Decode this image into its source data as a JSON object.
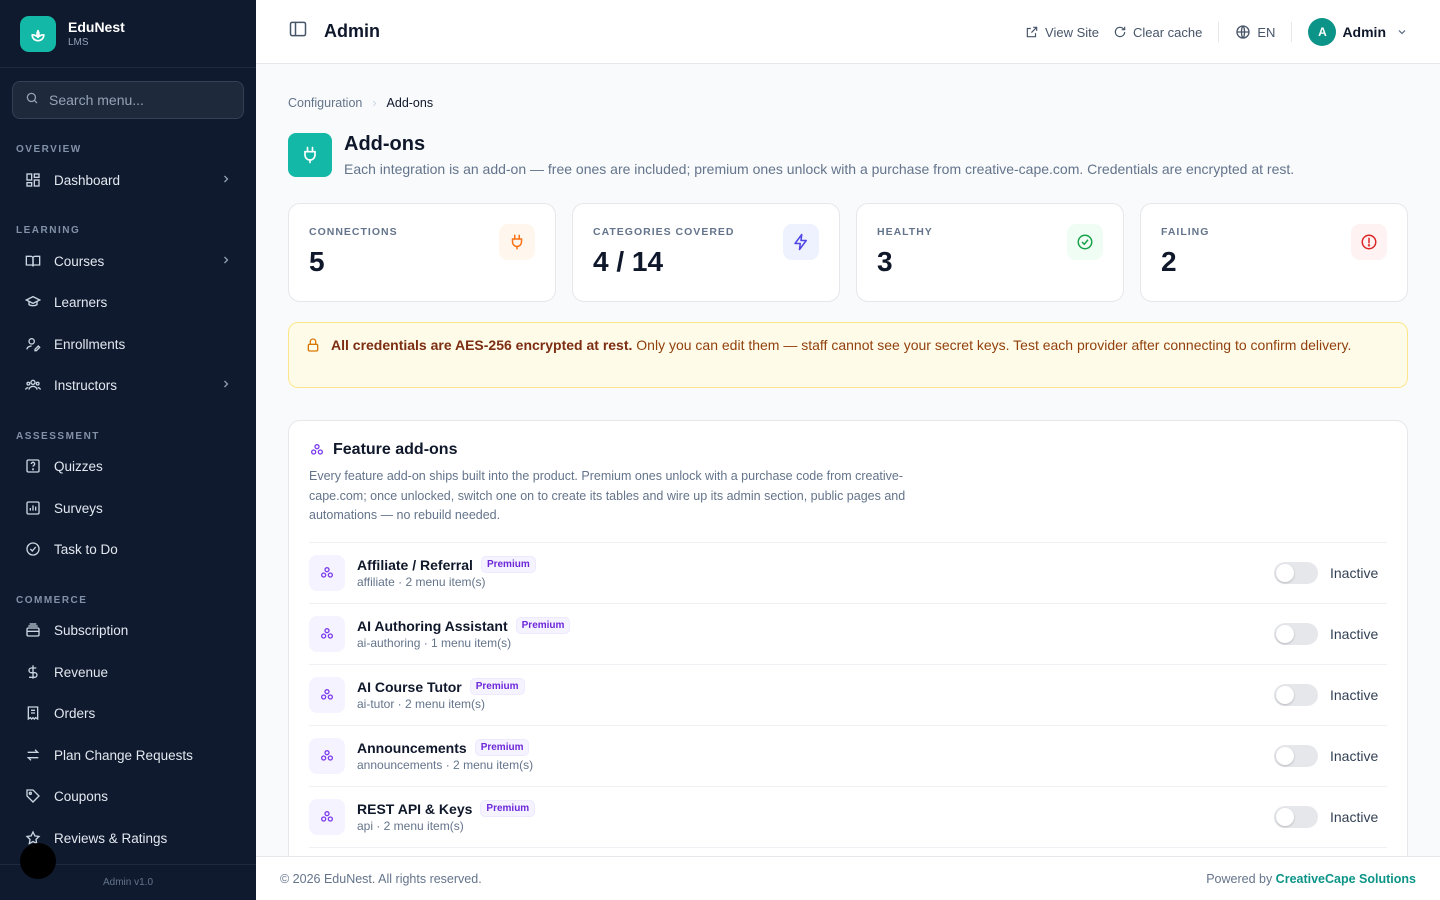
{
  "brand": {
    "name": "EduNest",
    "sub": "LMS"
  },
  "search": {
    "placeholder": "Search menu..."
  },
  "sidebar": {
    "sections": [
      "OVERVIEW",
      "LEARNING",
      "ASSESSMENT",
      "COMMERCE"
    ],
    "items": [
      {
        "label": "Dashboard",
        "icon": "dashboard-icon",
        "has_children": true
      },
      {
        "label": "Courses",
        "icon": "book-icon",
        "has_children": true
      },
      {
        "label": "Learners",
        "icon": "graduation-cap-icon",
        "has_children": false
      },
      {
        "label": "Enrollments",
        "icon": "user-edit-icon",
        "has_children": false
      },
      {
        "label": "Instructors",
        "icon": "users-icon",
        "has_children": true
      },
      {
        "label": "Quizzes",
        "icon": "quiz-icon",
        "has_children": false
      },
      {
        "label": "Surveys",
        "icon": "chart-icon",
        "has_children": false
      },
      {
        "label": "Task to Do",
        "icon": "check-circle-icon",
        "has_children": false
      },
      {
        "label": "Subscription",
        "icon": "stack-icon",
        "has_children": false
      },
      {
        "label": "Revenue",
        "icon": "dollar-icon",
        "has_children": false
      },
      {
        "label": "Orders",
        "icon": "receipt-icon",
        "has_children": false
      },
      {
        "label": "Plan Change Requests",
        "icon": "swap-icon",
        "has_children": false
      },
      {
        "label": "Coupons",
        "icon": "tag-icon",
        "has_children": false
      },
      {
        "label": "Reviews & Ratings",
        "icon": "star-icon",
        "has_children": false
      }
    ],
    "footer": "Admin v1.0"
  },
  "header": {
    "title": "Admin",
    "view_site": "View Site",
    "clear_cache": "Clear cache",
    "language": "EN",
    "avatar_initial": "A",
    "user": "Admin"
  },
  "breadcrumb": {
    "parent": "Configuration",
    "current": "Add-ons"
  },
  "page": {
    "title": "Add-ons",
    "description": "Each integration is an add-on — free ones are included; premium ones unlock with a purchase from creative-cape.com. Credentials are encrypted at rest."
  },
  "stats": [
    {
      "label": "CONNECTIONS",
      "value": "5",
      "icon": "plug-icon",
      "color": "#f97316",
      "bg": "#fff7ed"
    },
    {
      "label": "CATEGORIES COVERED",
      "value": "4 / 14",
      "icon": "bolt-icon",
      "color": "#4f46e5",
      "bg": "#eef2ff"
    },
    {
      "label": "HEALTHY",
      "value": "3",
      "icon": "check-circle-icon",
      "color": "#16a34a",
      "bg": "#f0fdf4"
    },
    {
      "label": "FAILING",
      "value": "2",
      "icon": "alert-circle-icon",
      "color": "#dc2626",
      "bg": "#fef2f2"
    }
  ],
  "notice": {
    "strong": "All credentials are AES-256 encrypted at rest.",
    "text": " Only you can edit them — staff cannot see your secret keys. Test each provider after connecting to confirm delivery."
  },
  "panel": {
    "title": "Feature add-ons",
    "description": "Every feature add-on ships built into the product. Premium ones unlock with a purchase code from creative-cape.com; once unlocked, switch one on to create its tables and wire up its admin section, public pages and automations — no rebuild needed.",
    "addons": [
      {
        "name": "Affiliate / Referral",
        "badge": "Premium",
        "slug": "affiliate · 2 menu item(s)",
        "status": "Inactive"
      },
      {
        "name": "AI Authoring Assistant",
        "badge": "Premium",
        "slug": "ai-authoring · 1 menu item(s)",
        "status": "Inactive"
      },
      {
        "name": "AI Course Tutor",
        "badge": "Premium",
        "slug": "ai-tutor · 2 menu item(s)",
        "status": "Inactive"
      },
      {
        "name": "Announcements",
        "badge": "Premium",
        "slug": "announcements · 2 menu item(s)",
        "status": "Inactive"
      },
      {
        "name": "REST API & Keys",
        "badge": "Premium",
        "slug": "api · 2 menu item(s)",
        "status": "Inactive"
      }
    ]
  },
  "footer": {
    "copyright": "© 2026 EduNest. All rights reserved.",
    "powered_prefix": "Powered by ",
    "powered_by": "CreativeCape Solutions"
  }
}
